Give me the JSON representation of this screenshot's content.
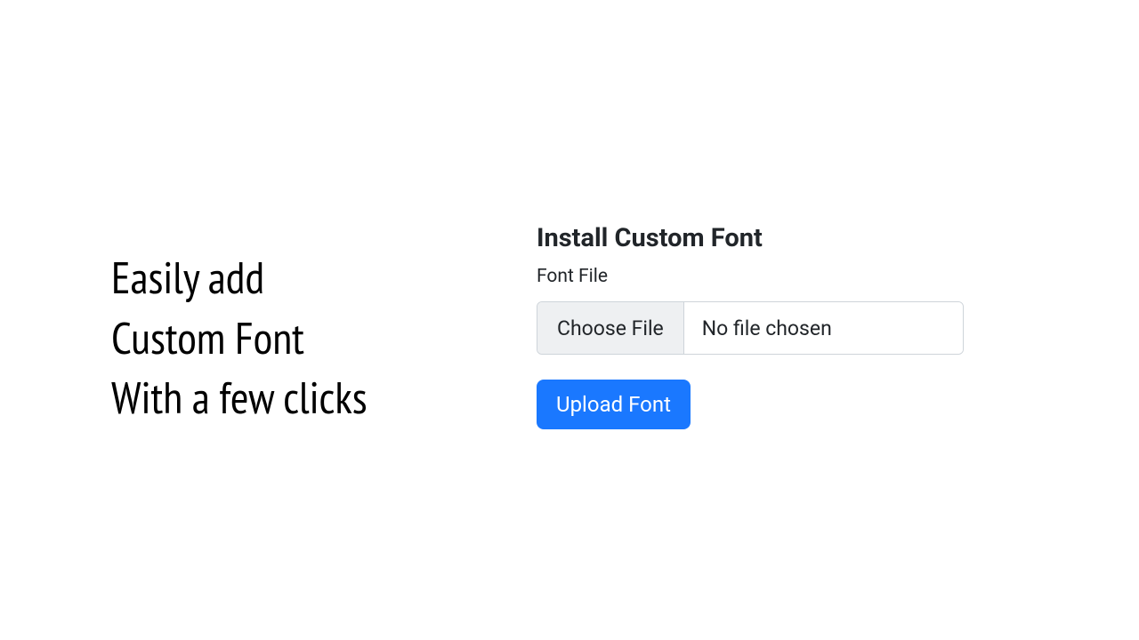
{
  "left": {
    "line1": "Easily add",
    "line2": "Custom Font",
    "line3": "With a few clicks"
  },
  "panel": {
    "title": "Install Custom Font",
    "field_label": "Font File",
    "choose_file_label": "Choose File",
    "file_status": "No file chosen",
    "upload_button_label": "Upload Font"
  }
}
